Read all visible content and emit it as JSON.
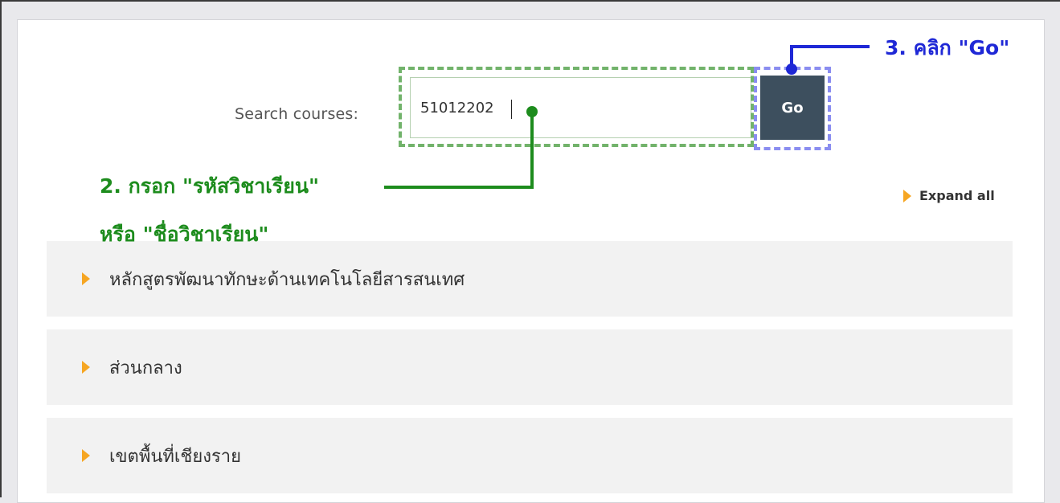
{
  "search": {
    "label": "Search courses:",
    "value": "51012202",
    "go_label": "Go"
  },
  "expand_all_label": "Expand all",
  "categories": [
    {
      "label": "หลักสูตรพัฒนาทักษะด้านเทคโนโลยีสารสนเทศ"
    },
    {
      "label": "ส่วนกลาง"
    },
    {
      "label": "เขตพื้นที่เชียงราย"
    }
  ],
  "annotations": {
    "step2_line1": "2. กรอก \"รหัสวิชาเรียน\"",
    "step2_line2": "หรือ \"ชื่อวิชาเรียน\"",
    "step3": "3. คลิก \"Go\"",
    "step2_color": "#1d8c1d",
    "step3_color": "#1f28d6"
  },
  "colors": {
    "go_button_bg": "#3d4f5e",
    "arrow_accent": "#f6a623",
    "category_bg": "#f2f2f2"
  }
}
